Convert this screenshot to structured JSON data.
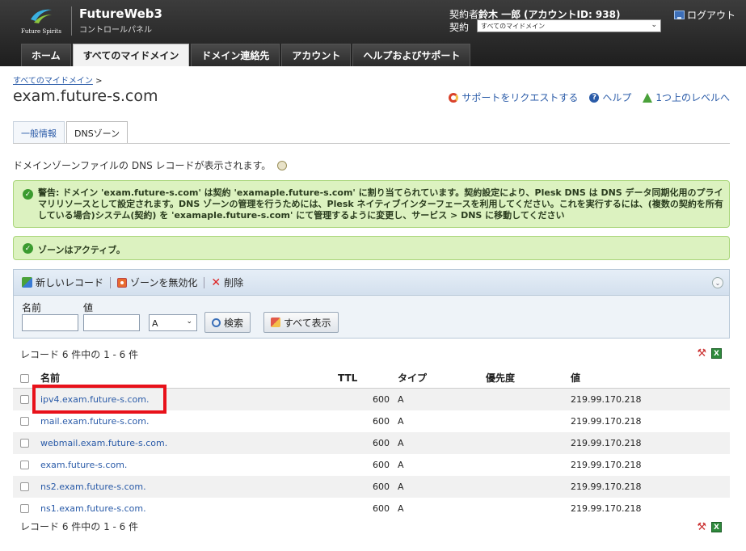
{
  "header": {
    "logo_text": "Future Spirits",
    "brand_title": "FutureWeb3",
    "brand_sub": "コントロールパネル",
    "account_prefix": "契約者",
    "account_name": "鈴木 一郎",
    "account_id": "(アカウントID: 938)",
    "contract_label": "契約",
    "contract_value": "すべてのマイドメイン",
    "logout_label": "ログアウト",
    "colors": {
      "header_bg": "#2b2b2b",
      "link": "#2a5ba8",
      "success_bg": "#dcf2c0",
      "highlight": "#e8111a"
    }
  },
  "main_tabs": [
    {
      "label": "ホーム",
      "active": false
    },
    {
      "label": "すべてのマイドメイン",
      "active": true
    },
    {
      "label": "ドメイン連絡先",
      "active": false
    },
    {
      "label": "アカウント",
      "active": false
    },
    {
      "label": "ヘルプおよびサポート",
      "active": false
    }
  ],
  "breadcrumb": {
    "link": "すべてのマイドメイン",
    "sep": ">"
  },
  "page_title": "exam.future-s.com",
  "top_links": {
    "support": "サポートをリクエストする",
    "help": "ヘルプ",
    "up_level": "1つ上のレベルへ"
  },
  "sub_tabs": [
    {
      "label": "一般情報",
      "active": false
    },
    {
      "label": "DNSゾーン",
      "active": true
    }
  ],
  "description": "ドメインゾーンファイルの DNS レコードが表示されます。",
  "warning": {
    "text": "警告: ドメイン 'exam.future-s.com' は契約 'examaple.future-s.com' に割り当てられています。契約設定により、Plesk DNS は DNS データ同期化用のプライマリリソースとして設定されます。DNS ゾーンの管理を行うためには、Plesk ネイティブインターフェースを利用してください。これを実行するには、(複数の契約を所有している場合)システム(契約) を 'examaple.future-s.com' にて管理するように変更し、サービス > DNS に移動してください"
  },
  "active_message": "ゾーンはアクティブ。",
  "toolbar": {
    "new_record": "新しいレコード",
    "disable_zone": "ゾーンを無効化",
    "delete": "削除"
  },
  "filter": {
    "name_label": "名前",
    "value_label": "値",
    "type_value": "A",
    "search_button": "検索",
    "show_all_button": "すべて表示"
  },
  "count_text": "レコード 6 件中の 1 - 6 件",
  "table": {
    "headers": {
      "name": "名前",
      "ttl": "TTL",
      "type": "タイプ",
      "priority": "優先度",
      "value": "値"
    },
    "rows": [
      {
        "name": "ipv4.exam.future-s.com.",
        "ttl": "600",
        "type": "A",
        "priority": "",
        "value": "219.99.170.218"
      },
      {
        "name": "mail.exam.future-s.com.",
        "ttl": "600",
        "type": "A",
        "priority": "",
        "value": "219.99.170.218"
      },
      {
        "name": "webmail.exam.future-s.com.",
        "ttl": "600",
        "type": "A",
        "priority": "",
        "value": "219.99.170.218"
      },
      {
        "name": "exam.future-s.com.",
        "ttl": "600",
        "type": "A",
        "priority": "",
        "value": "219.99.170.218"
      },
      {
        "name": "ns2.exam.future-s.com.",
        "ttl": "600",
        "type": "A",
        "priority": "",
        "value": "219.99.170.218"
      },
      {
        "name": "ns1.exam.future-s.com.",
        "ttl": "600",
        "type": "A",
        "priority": "",
        "value": "219.99.170.218"
      }
    ]
  }
}
